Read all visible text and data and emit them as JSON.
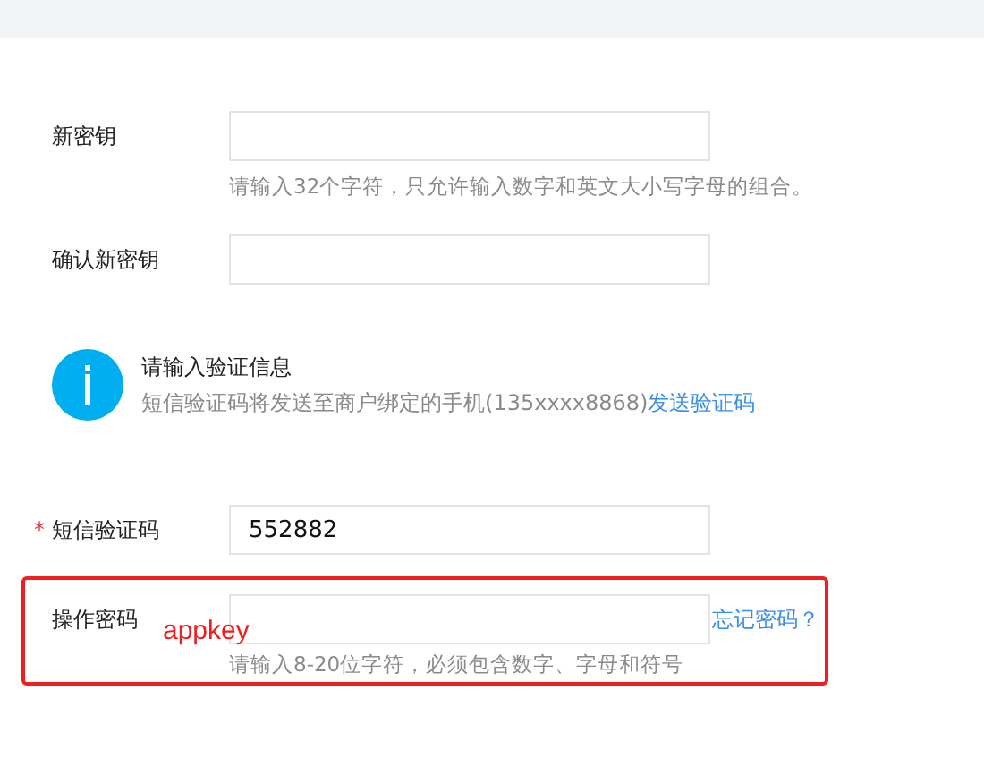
{
  "fields": [
    {
      "label": "新密钥",
      "hint": "请输入32个字符，只允许输入数字和英文大小写字母的组合。"
    },
    {
      "label": "确认新密钥"
    }
  ],
  "verification": {
    "title": "请输入验证信息",
    "text": "短信验证码将发送至商户绑定的手机(135xxxx8868)",
    "link": "发送验证码"
  },
  "sms_code": {
    "label": "短信验证码",
    "required": true,
    "required_mark": "*",
    "value": "552882"
  },
  "operation_password": {
    "label": "操作密码",
    "annotation": "appkey",
    "link": "忘记密码？",
    "hint": "请输入8-20位字符，必须包含数字、字母和符号"
  }
}
